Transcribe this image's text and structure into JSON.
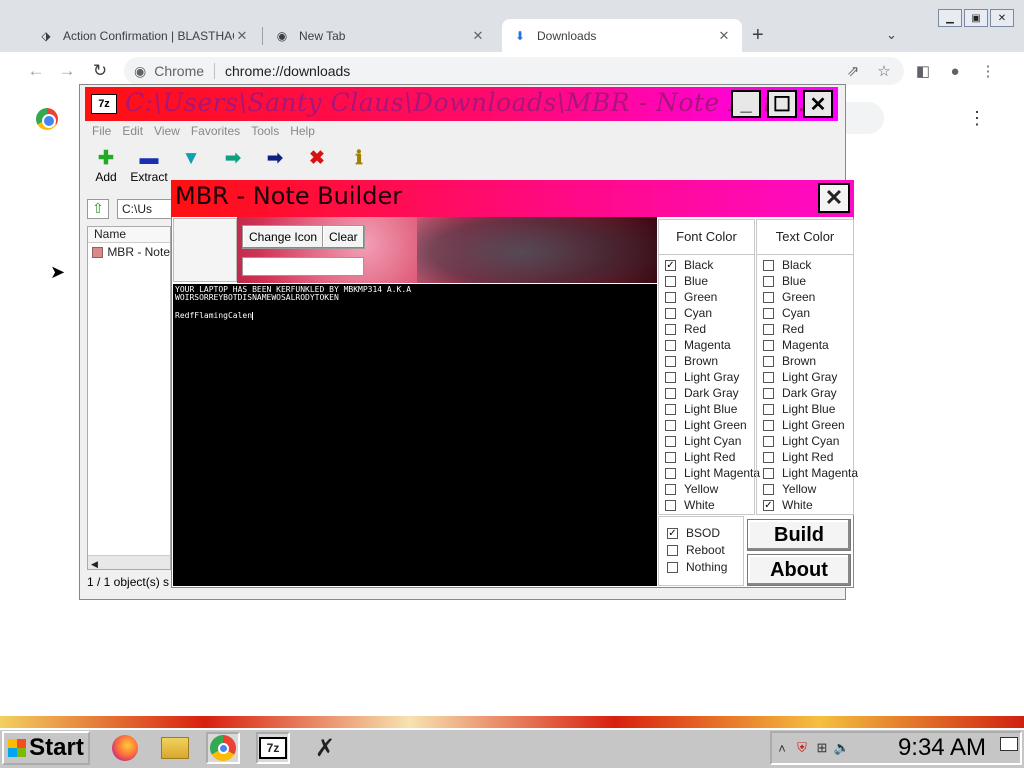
{
  "browser": {
    "tabs": [
      {
        "label": "Action Confirmation | BLASTHAC",
        "icon": "blasthack-icon"
      },
      {
        "label": "New Tab",
        "icon": "chrome-icon"
      },
      {
        "label": "Downloads",
        "icon": "download-icon"
      }
    ],
    "new_tab": "+",
    "omnibox": {
      "chip": "Chrome",
      "url": "chrome://downloads"
    }
  },
  "zip7": {
    "title": "C:\\Users\\Santy Claus\\Downloads\\MBR - Note Buil...",
    "menu": [
      "File",
      "Edit",
      "View",
      "Favorites",
      "Tools",
      "Help"
    ],
    "toolbar": [
      {
        "label": "Add",
        "glyph": "✚",
        "color": "#22aa22"
      },
      {
        "label": "Extract",
        "glyph": "▬",
        "color": "#1a2fb0"
      },
      {
        "label": "",
        "glyph": "▼",
        "color": "#10a0b0"
      },
      {
        "label": "",
        "glyph": "➡",
        "color": "#10a080"
      },
      {
        "label": "",
        "glyph": "➡",
        "color": "#102080"
      },
      {
        "label": "",
        "glyph": "✖",
        "color": "#dd1010"
      },
      {
        "label": "",
        "glyph": "ℹ",
        "color": "#a08000"
      }
    ],
    "address": "C:\\Us",
    "column_name": "Name",
    "file_item": "MBR - Note",
    "status": "1 / 1 object(s) s"
  },
  "note_builder": {
    "title": "MBR - Note Builder",
    "change_icon": "Change Icon",
    "clear": "Clear",
    "console_text": "YOUR LAPTOP HAS BEEN KERFUNKLED BY MBKMP314 A.K.A\nWOIRSORREYBOTDISNAMEWOSALRODYTOKEN",
    "console_input": "RedfFlamingCalen",
    "font_color_header": "Font Color",
    "text_color_header": "Text Color",
    "colors": [
      "Black",
      "Blue",
      "Green",
      "Cyan",
      "Red",
      "Magenta",
      "Brown",
      "Light Gray",
      "Dark Gray",
      "Light Blue",
      "Light Green",
      "Light Cyan",
      "Light Red",
      "Light Magenta",
      "Yellow",
      "White"
    ],
    "font_color_selected": "Black",
    "text_color_selected": "White",
    "actions": [
      "BSOD",
      "Reboot",
      "Nothing"
    ],
    "action_selected": "BSOD",
    "build": "Build",
    "about": "About"
  },
  "taskbar": {
    "start": "Start",
    "clock": "9:34 AM"
  }
}
